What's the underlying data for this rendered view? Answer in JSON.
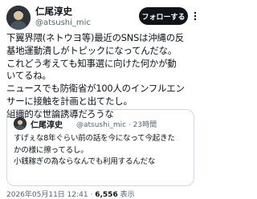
{
  "post": {
    "display_name": "仁尾淳史",
    "handle": "@atsushi_mic",
    "follow_label": "フォローする",
    "body_lines": [
      "下翼界隈(ネトウヨ等)最近のSNSは沖縄の反",
      "基地運動潰しがトピックになってんだな。",
      "これどう考えても知事選に向けた何かが動",
      "いてるね。",
      "ニュースでも防衛省が100人のインフルエン",
      "サーに接触を計画と出てたし。",
      "組織的な世論誘導だろうな"
    ]
  },
  "quote": {
    "display_name": "仁尾淳史",
    "handle": "@atsushi_mic",
    "time": "23時間",
    "lines": [
      "すげぇな8年ぐらい前の話を今になって今起きた",
      "かの様に擦ってるし。",
      "小銭稼ぎの為ならなんでも利用するんだな"
    ]
  },
  "footer": {
    "datetime": "2026年05月11日 12:41",
    "separator": "·",
    "views": "6,556",
    "views_label": "表示"
  },
  "icons": {
    "more": "more-icon",
    "avatar": "avatar"
  },
  "colors": {
    "follow_bg": "#0f1419",
    "secondary_text": "#536471",
    "border": "#cfd9de"
  }
}
